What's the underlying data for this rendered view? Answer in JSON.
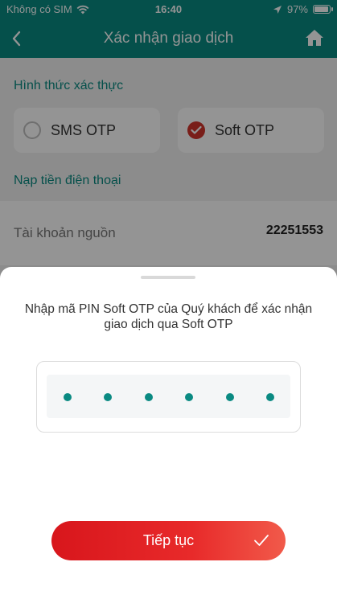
{
  "status_bar": {
    "carrier": "Không có SIM",
    "time": "16:40",
    "battery": "97%",
    "battery_level": 0.97
  },
  "header": {
    "title": "Xác nhận giao dịch",
    "back_icon": "chevron-left-icon",
    "home_icon": "home-icon"
  },
  "auth": {
    "section_label": "Hình thức xác thực",
    "options": [
      {
        "label": "SMS OTP",
        "selected": false
      },
      {
        "label": "Soft OTP",
        "selected": true
      }
    ]
  },
  "topup": {
    "section_label": "Nạp tiền điện thoại",
    "source_label": "Tài khoản nguồn",
    "source_value": "22251553"
  },
  "sheet": {
    "instruction": "Nhập mã PIN Soft OTP của Quý khách để xác nhận giao dịch qua Soft OTP",
    "pin_length": 6,
    "continue_label": "Tiếp tục"
  },
  "colors": {
    "accent": "#0a8a82",
    "button": "#e02020",
    "check": "#d0342c"
  }
}
